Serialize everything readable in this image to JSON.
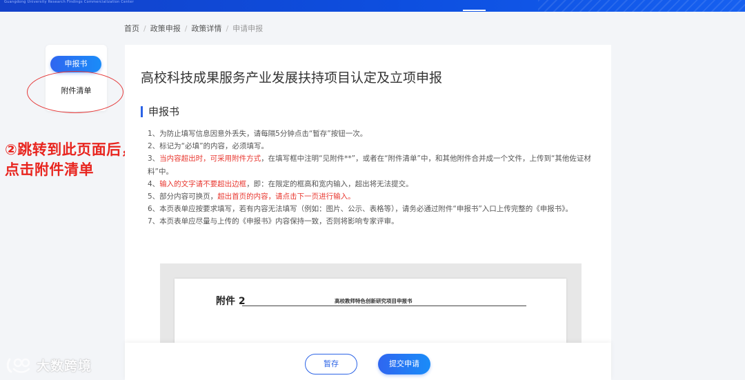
{
  "header": {
    "org_name": "Guangdong University Research Findings Commercialization Center"
  },
  "breadcrumb": {
    "items": [
      "首页",
      "政策申报",
      "政策详情",
      "申请申报"
    ],
    "separator": "/"
  },
  "sidebar": {
    "items": [
      {
        "label": "申报书",
        "active": true
      },
      {
        "label": "附件清单",
        "active": false
      }
    ]
  },
  "annotation": {
    "line1": "②跳转到此页面后，",
    "line2": "点击附件清单",
    "color": "#e8251f"
  },
  "main": {
    "title": "高校科技成果服务产业发展扶持项目认定及立项申报",
    "section_title": "申报书",
    "notes": [
      {
        "parts": [
          {
            "text": "1、为防止填写信息因意外丢失，请每隔5分钟点击“暂存”按钮一次。",
            "red": false
          }
        ]
      },
      {
        "parts": [
          {
            "text": "2、标记为“必填”的内容，必须填写。",
            "red": false
          }
        ]
      },
      {
        "parts": [
          {
            "text": "3、",
            "red": false
          },
          {
            "text": "当内容超出时，可采用附件方式",
            "red": true
          },
          {
            "text": "，在填写框中注明“见附件**”，或者在“附件清单”中，和其他附件合并成一个文件，上传到“其他佐证材料”中。",
            "red": false
          }
        ]
      },
      {
        "parts": [
          {
            "text": "4、",
            "red": false
          },
          {
            "text": "输入的文字请不要超出边框",
            "red": true
          },
          {
            "text": "，即：在限定的框高和宽内输入，超出将无法提交。",
            "red": false
          }
        ]
      },
      {
        "parts": [
          {
            "text": "5、部分内容可换页，",
            "red": false
          },
          {
            "text": "超出首页的内容，请点击下一页进行输入。",
            "red": true
          }
        ]
      },
      {
        "parts": [
          {
            "text": "6、本页表单应按要求填写，若有内容无法填写（例如：图片、公示、表格等），请务必通过附件“申报书”入口上传完整的《申报书》。",
            "red": false
          }
        ]
      },
      {
        "parts": [
          {
            "text": "7、本页表单应尽量与上传的《申报书》内容保持一致，否则将影响专家评审。",
            "red": false
          }
        ]
      }
    ],
    "red_color": "#e8372f"
  },
  "preview": {
    "attachment_label": "附件 2",
    "doc_title": "高校教师特色创新研究项目申报书"
  },
  "footer": {
    "save_label": "暂存",
    "submit_label": "提交申请"
  },
  "watermark": {
    "text": "大数跨境"
  },
  "colors": {
    "primary": "#2b63e6",
    "header_blue": "#0d4fe0"
  }
}
